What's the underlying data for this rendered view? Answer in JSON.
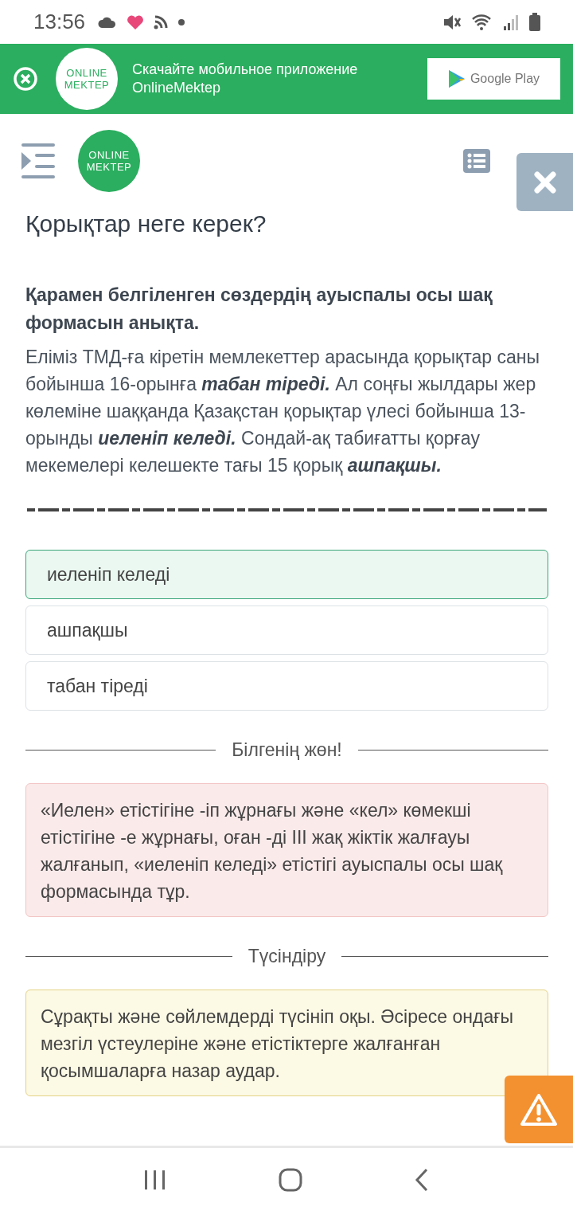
{
  "status_bar": {
    "time": "13:56"
  },
  "app_banner": {
    "logo_text": [
      "ONLINE",
      "MEKTEP"
    ],
    "text": "Скачайте мобильное приложение OnlineMektep",
    "store_button": "Google Play"
  },
  "header": {
    "logo_text": [
      "ONLINE",
      "MEKTEP"
    ]
  },
  "page_title": "Қорықтар неге керек?",
  "question": "Қарамен белгіленген сөздердің ауыспалы осы шақ формасын анықта.",
  "passage": "Еліміз ТМД-ға кіретін мемлекеттер арасында қорықтар саны бойынша 16-орынға **табан тіреді.** Ал соңғы жылдары жер көлеміне шаққанда Қазақстан қорықтар үлесі бойынша 13-орынды **иеленіп келеді.** Сондай-ақ табиғатты қорғау мекемелері келешекте тағы 15 қорық **ашпақшы.**",
  "options": [
    {
      "label": "иеленіп келеді",
      "selected": true
    },
    {
      "label": "ашпақшы",
      "selected": false
    },
    {
      "label": "табан тіреді",
      "selected": false
    }
  ],
  "feedback": {
    "heading": "Білгенің жөн!",
    "text": "«Иелен» етістігіне -іп жұрнағы және «кел» көмекші етістігіне -е жұрнағы, оған -ді ІІІ жақ жіктік жалғауы жалғанып, «иеленіп келеді» етістігі ауыспалы осы шақ формасында тұр."
  },
  "explanation": {
    "heading": "Түсіндіру",
    "text": "Сұрақты және сөйлемдерді түсініп оқы. Әсіресе ондағы мезгіл үстеулеріне және етістіктерге жалғанған қосымшаларға назар аудар."
  }
}
